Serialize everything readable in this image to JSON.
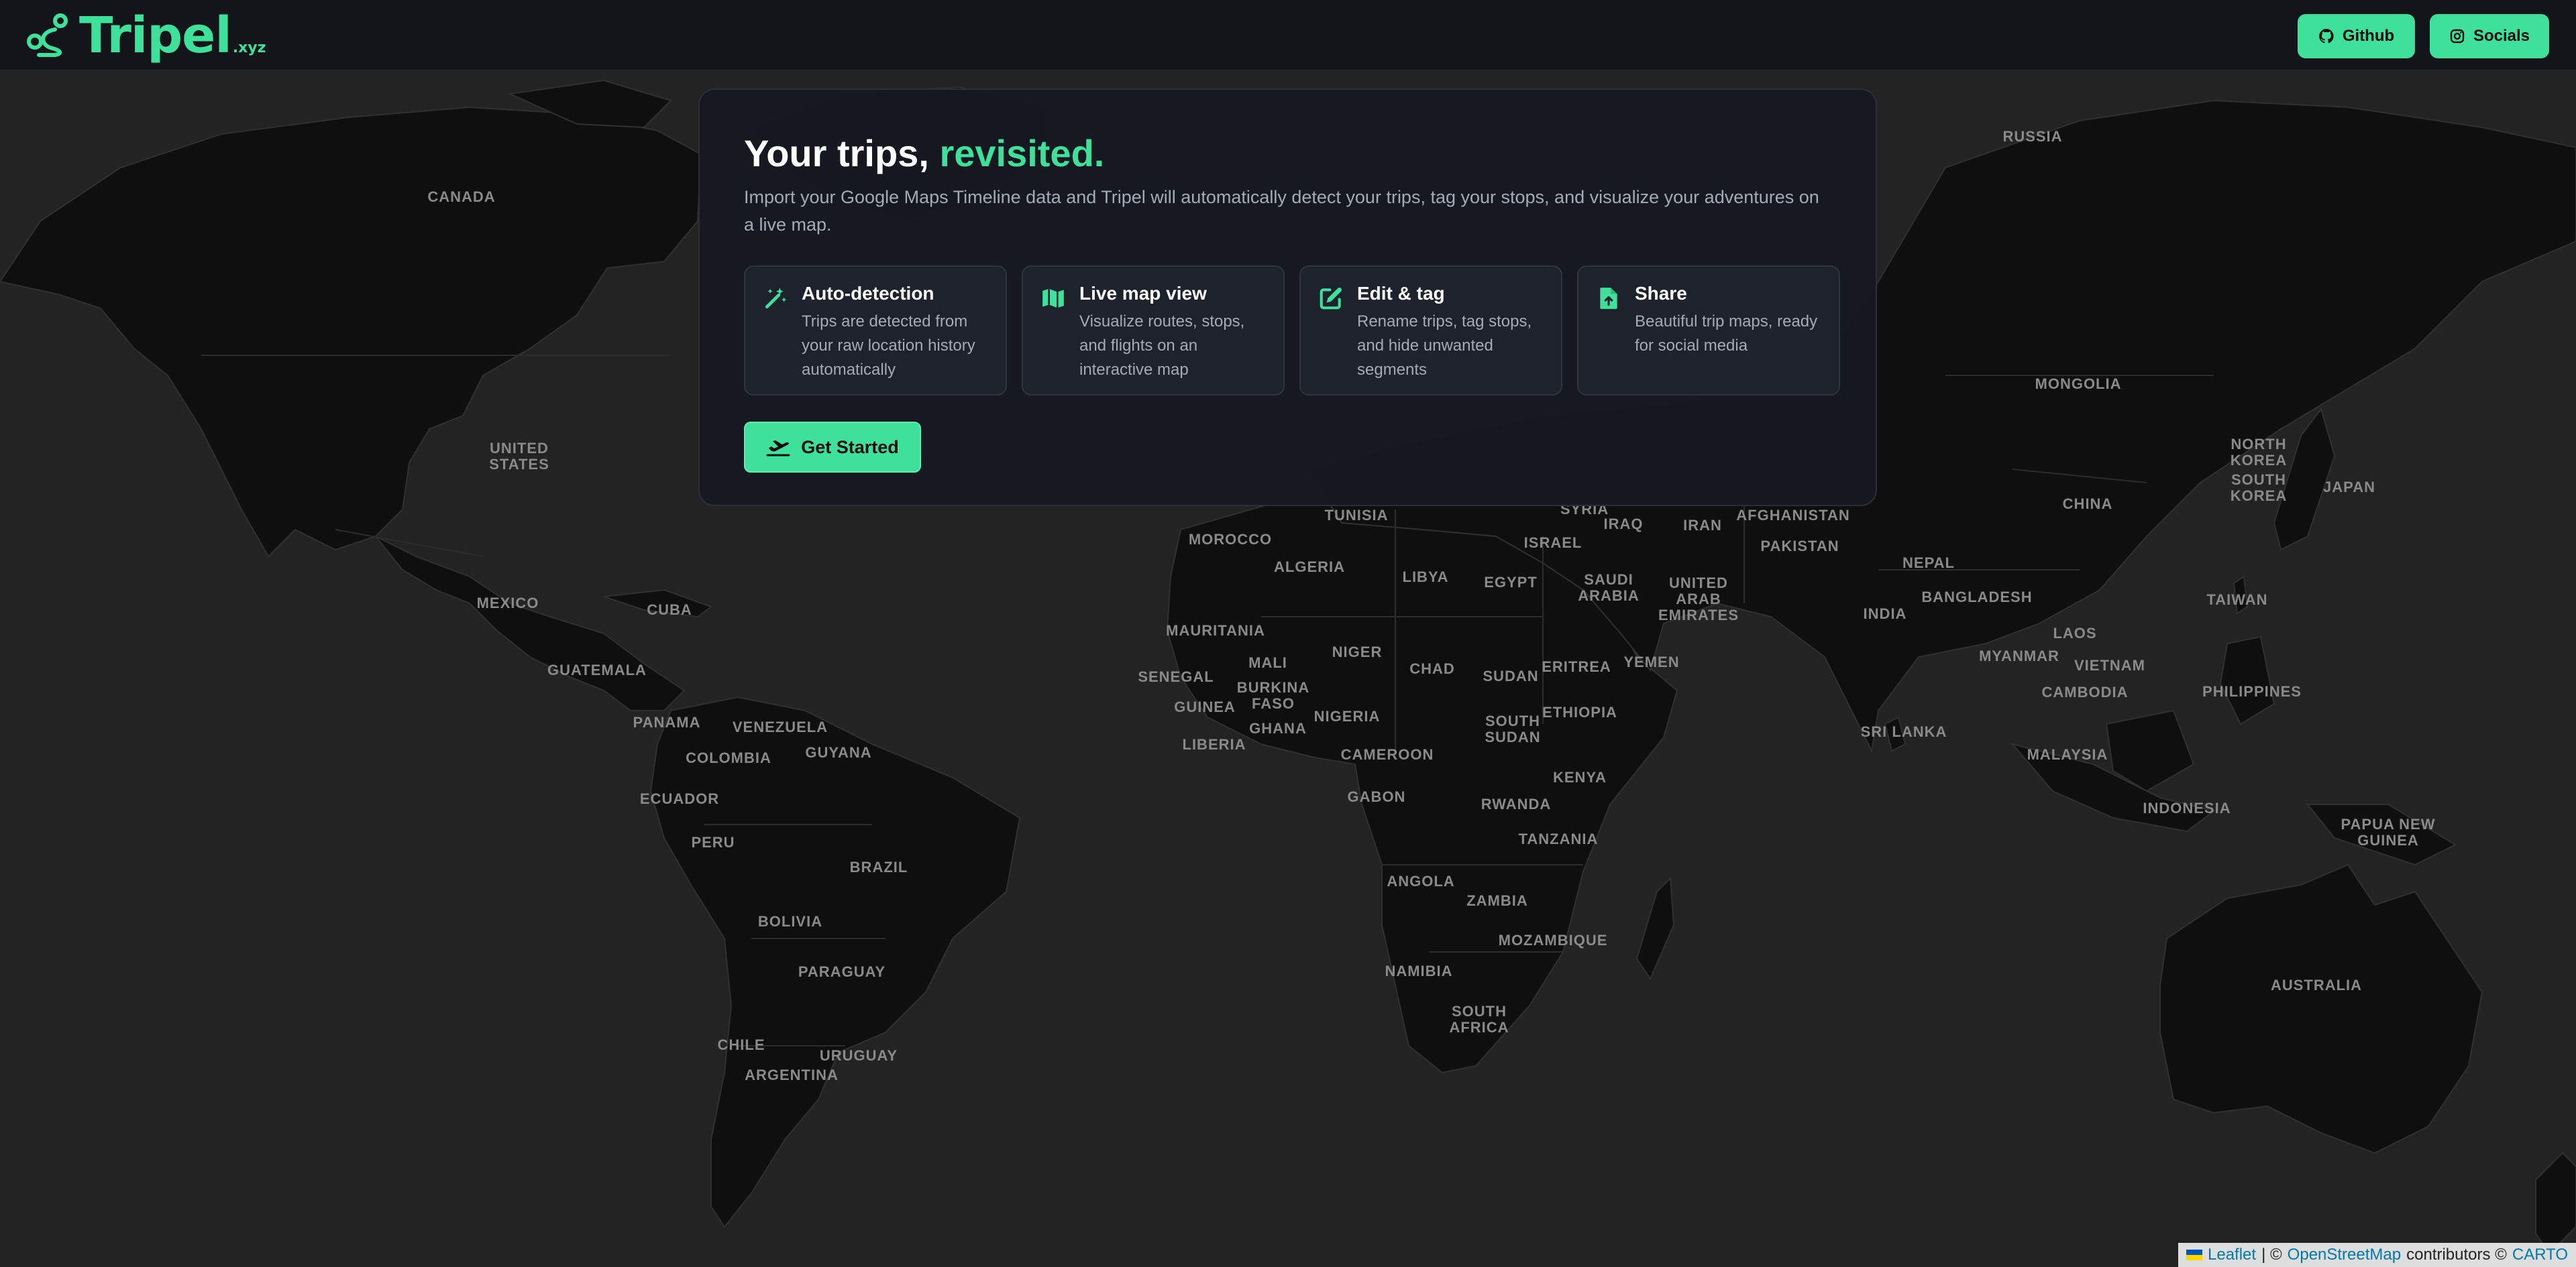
{
  "header": {
    "logo_text": "Tripel",
    "logo_suffix": ".xyz",
    "github_label": "Github",
    "socials_label": "Socials"
  },
  "hero": {
    "title_main": "Your trips, ",
    "title_accent": "revisited.",
    "subtitle": "Import your Google Maps Timeline data and Tripel will automatically detect your trips, tag your stops, and visualize your adventures on a live map.",
    "features": [
      {
        "icon": "magic-wand-icon",
        "title": "Auto-detection",
        "text": "Trips are detected from your raw location history automatically"
      },
      {
        "icon": "map-icon",
        "title": "Live map view",
        "text": "Visualize routes, stops, and flights on an interactive map"
      },
      {
        "icon": "edit-icon",
        "title": "Edit & tag",
        "text": "Rename trips, tag stops, and hide unwanted segments"
      },
      {
        "icon": "file-share-icon",
        "title": "Share",
        "text": "Beautiful trip maps, ready for social media"
      }
    ],
    "cta_label": "Get Started"
  },
  "map": {
    "labels": [
      "RUSSIA",
      "CANADA",
      "UNITED STATES",
      "MEXICO",
      "CUBA",
      "GUATEMALA",
      "PANAMA",
      "VENEZUELA",
      "COLOMBIA",
      "GUYANA",
      "ECUADOR",
      "PERU",
      "BRAZIL",
      "BOLIVIA",
      "PARAGUAY",
      "CHILE",
      "URUGUAY",
      "ARGENTINA",
      "MOROCCO",
      "TUNISIA",
      "ALGERIA",
      "LIBYA",
      "EGYPT",
      "MAURITANIA",
      "MALI",
      "NIGER",
      "CHAD",
      "SUDAN",
      "SENEGAL",
      "GUINEA",
      "BURKINA FASO",
      "GHANA",
      "NIGERIA",
      "LIBERIA",
      "CAMEROON",
      "GABON",
      "ETHIOPIA",
      "SOUTH SUDAN",
      "ERITREA",
      "KENYA",
      "RWANDA",
      "TANZANIA",
      "ANGOLA",
      "ZAMBIA",
      "MOZAMBIQUE",
      "NAMIBIA",
      "SOUTH AFRICA",
      "SYRIA",
      "IRAQ",
      "IRAN",
      "ISRAEL",
      "SAUDI ARABIA",
      "UNITED ARAB EMIRATES",
      "YEMEN",
      "AFGHANISTAN",
      "PAKISTAN",
      "NEPAL",
      "INDIA",
      "BANGLADESH",
      "SRI LANKA",
      "MONGOLIA",
      "CHINA",
      "NORTH KOREA",
      "SOUTH KOREA",
      "JAPAN",
      "TAIWAN",
      "MYANMAR",
      "LAOS",
      "VIETNAM",
      "CAMBODIA",
      "PHILIPPINES",
      "MALAYSIA",
      "INDONESIA",
      "PAPUA NEW GUINEA",
      "AUSTRALIA"
    ]
  },
  "attribution": {
    "leaflet": "Leaflet",
    "sep": "| ©",
    "osm": "OpenStreetMap",
    "contrib": "contributors ©",
    "carto": "CARTO"
  },
  "colors": {
    "accent": "#3ee09a",
    "background": "#232323",
    "land": "#0f0f10",
    "card": "#161922"
  }
}
